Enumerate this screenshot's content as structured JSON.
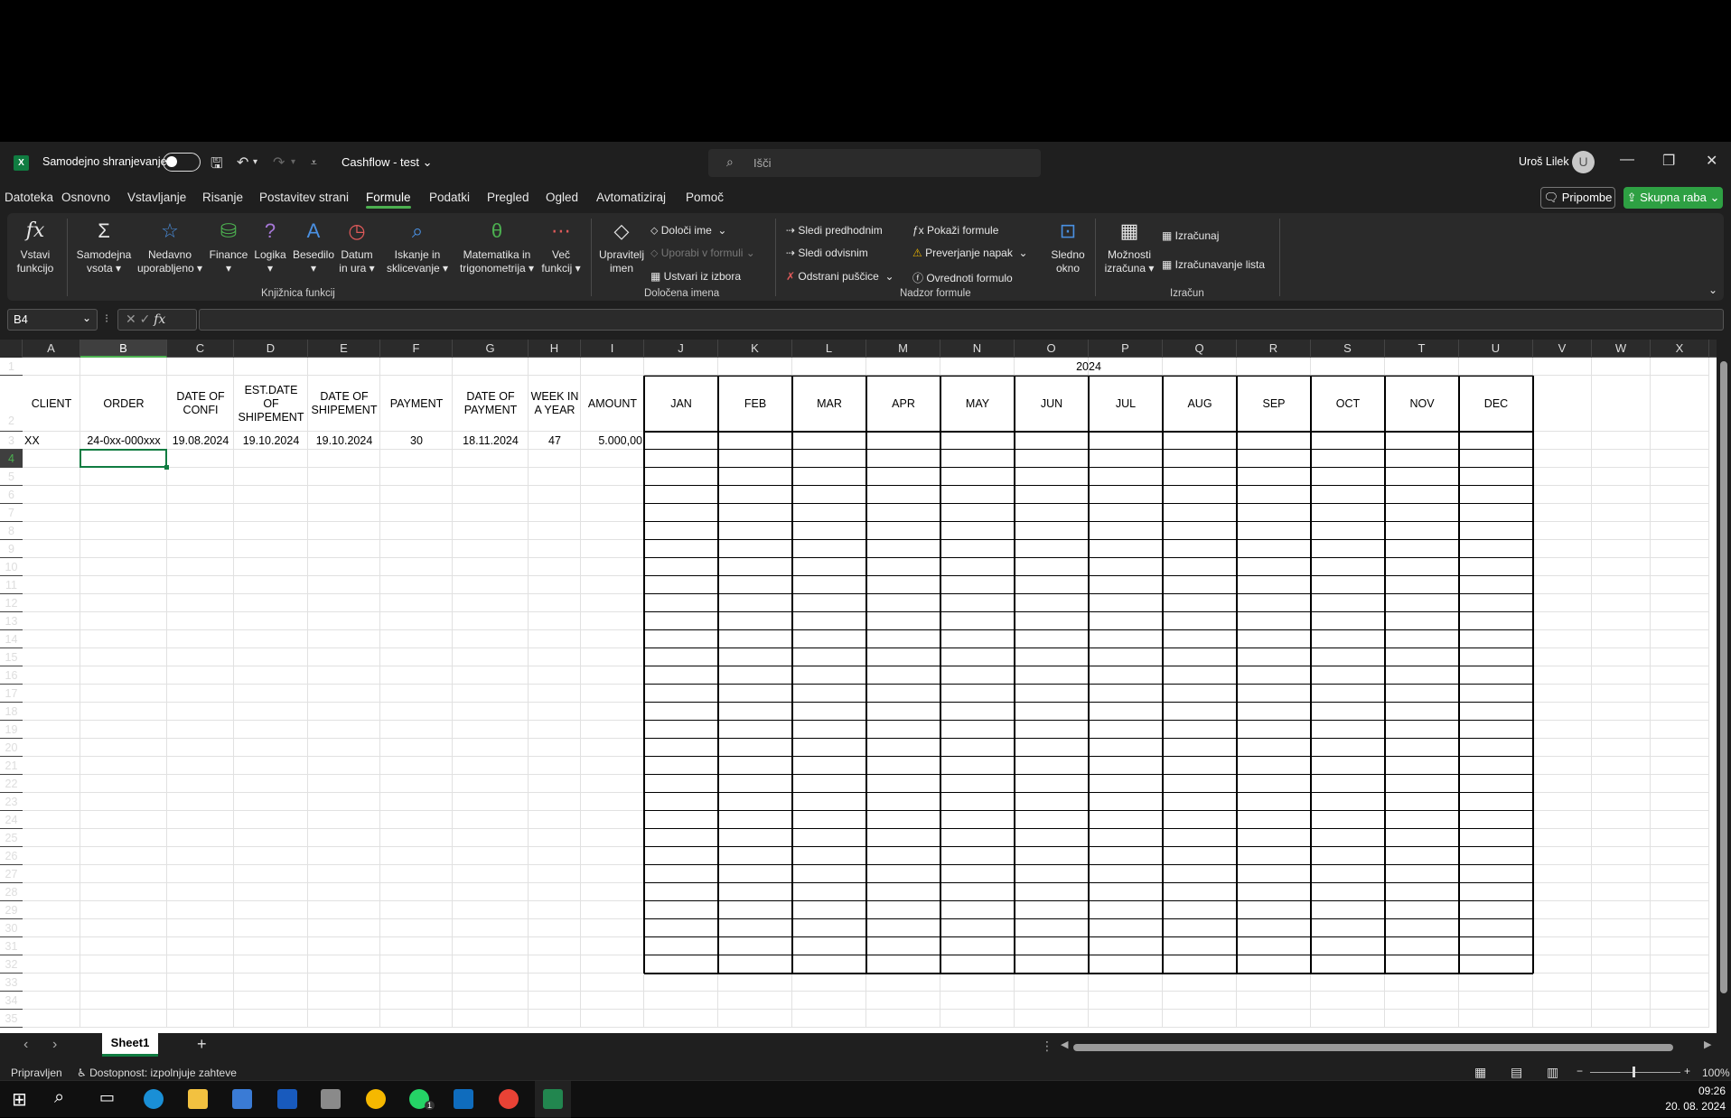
{
  "titlebar": {
    "logo": "X",
    "autosave_label": "Samodejno shranjevanje",
    "doc_title": "Cashflow - test",
    "search_placeholder": "Išči",
    "user": "Uroš Lilek",
    "user_initial": "U"
  },
  "menu": {
    "tabs": [
      "Datoteka",
      "Osnovno",
      "Vstavljanje",
      "Risanje",
      "Postavitev strani",
      "Formule",
      "Podatki",
      "Pregled",
      "Ogled",
      "Avtomatiziraj",
      "Pomoč"
    ],
    "active": "Formule",
    "comments": "Pripombe",
    "share": "Skupna raba"
  },
  "ribbon": {
    "insert_function": [
      "Vstavi",
      "funkcijo"
    ],
    "autosum": [
      "Samodejna",
      "vsota"
    ],
    "recent": [
      "Nedavno",
      "uporabljeno"
    ],
    "finance": "Finance",
    "logic": "Logika",
    "text": "Besedilo",
    "datetime": [
      "Datum",
      "in ura"
    ],
    "lookup": [
      "Iskanje in",
      "sklicevanje"
    ],
    "math": [
      "Matematika in",
      "trigonometrija"
    ],
    "more": [
      "Več",
      "funkcij"
    ],
    "group_library": "Knjižnica funkcij",
    "name_manager": [
      "Upravitelj",
      "imen"
    ],
    "define_name": "Določi ime",
    "use_in_formula": "Uporabi v formuli",
    "create_from_selection": "Ustvari iz izbora",
    "group_names": "Določena imena",
    "trace_precedents": "Sledi predhodnim",
    "trace_dependents": "Sledi odvisnim",
    "remove_arrows": "Odstrani puščice",
    "show_formulas": "Pokaži formule",
    "error_checking": "Preverjanje napak",
    "evaluate_formula": "Ovrednoti formulo",
    "group_audit": "Nadzor formule",
    "watch_window": [
      "Sledno",
      "okno"
    ],
    "calc_options": [
      "Možnosti",
      "izračuna"
    ],
    "calculate_now": "Izračunaj",
    "calculate_sheet": "Izračunavanje lista",
    "group_calc": "Izračun"
  },
  "formula_bar": {
    "name_box": "B4",
    "fx": "fx",
    "content": ""
  },
  "sheet": {
    "columns": [
      "A",
      "B",
      "C",
      "D",
      "E",
      "F",
      "G",
      "H",
      "I",
      "J",
      "K",
      "L",
      "M",
      "N",
      "O",
      "P",
      "Q",
      "R",
      "S",
      "T",
      "U",
      "V",
      "W",
      "X"
    ],
    "selected_column": "B",
    "selected_row": 4,
    "year_header": "2024",
    "headers": [
      "CLIENT",
      "ORDER",
      "DATE OF\nCONFI",
      "EST.DATE\nOF\nSHIPEMENT",
      "DATE OF\nSHIPEMENT",
      "PAYMENT",
      "DATE OF\nPAYMENT",
      "WEEK IN\nA YEAR",
      "AMOUNT"
    ],
    "months": [
      "JAN",
      "FEB",
      "MAR",
      "APR",
      "MAY",
      "JUN",
      "JUL",
      "AUG",
      "SEP",
      "OCT",
      "NOV",
      "DEC"
    ],
    "row3": [
      "XX",
      "24-0xx-000xxx",
      "19.08.2024",
      "19.10.2024",
      "19.10.2024",
      "30",
      "18.11.2024",
      "47",
      "5.000,00"
    ]
  },
  "tabs_bar": {
    "sheet_tab": "Sheet1",
    "add": "+"
  },
  "status": {
    "ready": "Pripravljen",
    "accessibility": "Dostopnost: izpolnjuje zahteve",
    "zoom": "100%"
  },
  "taskbar": {
    "time": "09:26",
    "date": "20. 08. 2024",
    "whatsapp_badge": "1"
  },
  "colors": {
    "accent": "#4cb050",
    "excel_green": "#107c41",
    "share_green": "#2ea043"
  }
}
